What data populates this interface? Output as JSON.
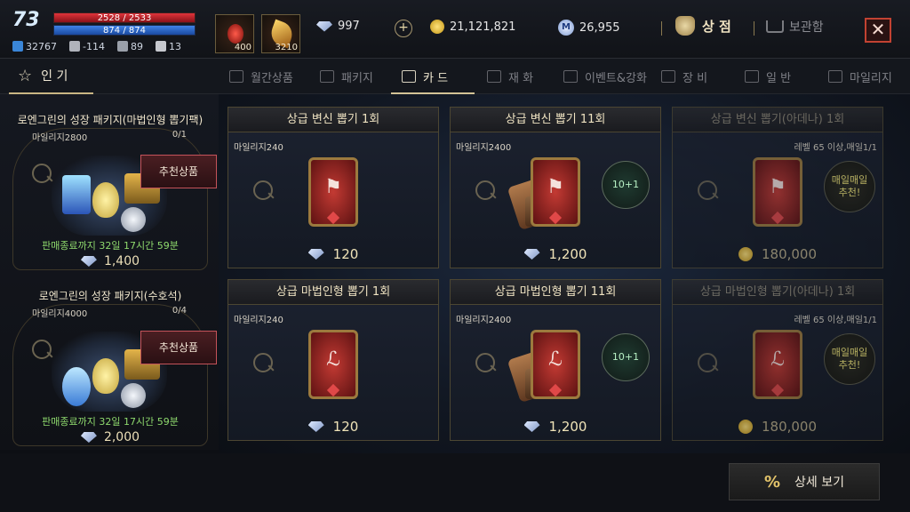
{
  "player": {
    "level": "73",
    "hp": "2528 / 2533",
    "mp": "874 / 874",
    "stats": [
      {
        "icon": "wing-icon",
        "value": "32767"
      },
      {
        "icon": "helmet-icon",
        "value": "-114"
      },
      {
        "icon": "shield-icon",
        "value": "89"
      },
      {
        "icon": "weight-icon",
        "value": "13"
      }
    ]
  },
  "quick_items": [
    {
      "icon": "red-potion-icon",
      "count": "400"
    },
    {
      "icon": "golden-leaf-icon",
      "count": "3210"
    }
  ],
  "currencies": {
    "diamond": "997",
    "adena": "21,121,821",
    "mileage": "26,955",
    "mileage_symbol": "M"
  },
  "header": {
    "shop_label": "상 점",
    "storage_label": "보관함",
    "close_label": "✕",
    "plus_label": "+"
  },
  "tabs": {
    "popular": "인 기",
    "items": [
      {
        "label": "월간상품",
        "active": false
      },
      {
        "label": "패키지",
        "active": false
      },
      {
        "label": "카 드",
        "active": true
      },
      {
        "label": "재 화",
        "active": false
      },
      {
        "label": "이벤트&강화",
        "active": false
      },
      {
        "label": "장 비",
        "active": false
      },
      {
        "label": "일 반",
        "active": false
      },
      {
        "label": "마일리지",
        "active": false
      }
    ]
  },
  "packages": [
    {
      "title": "로엔그린의 성장 패키지(마법인형 뽑기팩)",
      "mileage": "마일리지2800",
      "count": "0/1",
      "badge": "추천상품",
      "timer": "판매종료까지 32일 17시간 59분",
      "price": "1,400"
    },
    {
      "title": "로엔그린의 성장 패키지(수호석)",
      "mileage": "마일리지4000",
      "count": "0/4",
      "badge": "추천상품",
      "timer": "판매종료까지 32일 17시간 59분",
      "price": "2,000"
    }
  ],
  "cards": [
    {
      "title": "상급 변신 뽑기 1회",
      "mileage": "마일리지240",
      "note": "",
      "badge": "",
      "price": "120",
      "currency": "diamond",
      "kind": "transform",
      "stack": false,
      "dim": false
    },
    {
      "title": "상급 변신 뽑기 11회",
      "mileage": "마일리지2400",
      "note": "",
      "badge": "10+1",
      "price": "1,200",
      "currency": "diamond",
      "kind": "transform",
      "stack": true,
      "dim": false
    },
    {
      "title": "상급 변신 뽑기(아데나) 1회",
      "mileage": "",
      "note": "레벨 65 이상,매일1/1",
      "badge": "매일매일\n추천!",
      "price": "180,000",
      "currency": "adena",
      "kind": "transform",
      "stack": false,
      "dim": true
    },
    {
      "title": "상급 마법인형 뽑기 1회",
      "mileage": "마일리지240",
      "note": "",
      "badge": "",
      "price": "120",
      "currency": "diamond",
      "kind": "doll",
      "stack": false,
      "dim": false
    },
    {
      "title": "상급 마법인형 뽑기 11회",
      "mileage": "마일리지2400",
      "note": "",
      "badge": "10+1",
      "price": "1,200",
      "currency": "diamond",
      "kind": "doll",
      "stack": true,
      "dim": false
    },
    {
      "title": "상급 마법인형 뽑기(아데나) 1회",
      "mileage": "",
      "note": "레벨 65 이상,매일1/1",
      "badge": "매일매일\n추천!",
      "price": "180,000",
      "currency": "adena",
      "kind": "doll",
      "stack": false,
      "dim": true
    }
  ],
  "footer": {
    "detail_label": "상세 보기",
    "detail_icon": "%"
  }
}
